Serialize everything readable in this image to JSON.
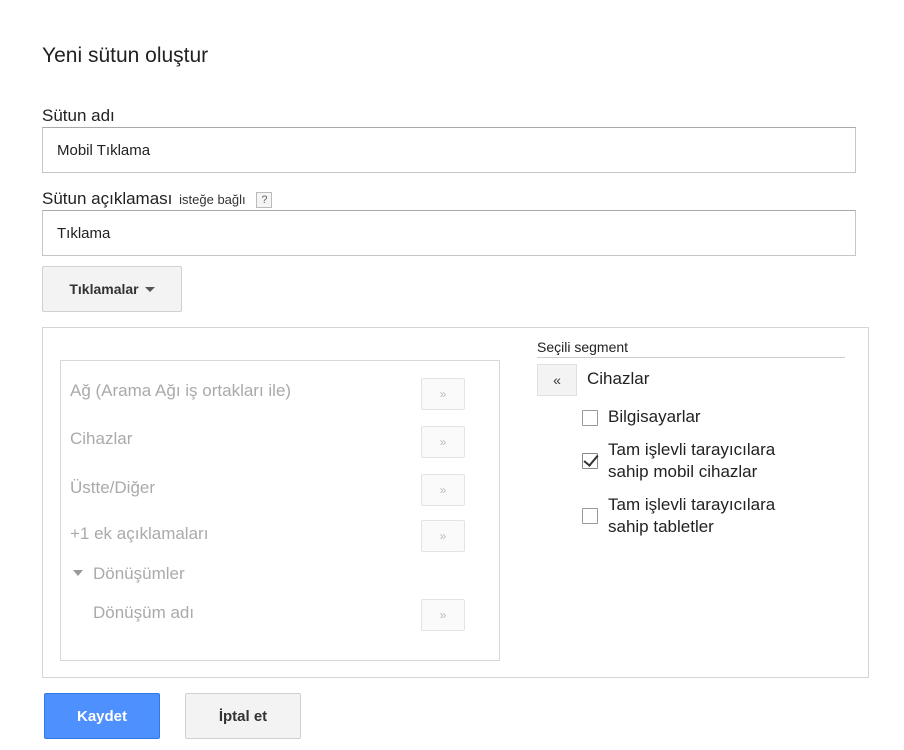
{
  "dialog": {
    "title": "Yeni sütun oluştur",
    "column_name": {
      "label": "Sütun adı",
      "value": "Mobil Tıklama"
    },
    "column_description": {
      "label": "Sütun açıklaması",
      "optional_text": "isteğe bağlı",
      "help_text": "?",
      "value": "Tıklama"
    },
    "metric_button_label": "Tıklamalar",
    "segments": {
      "items": [
        {
          "label": "Ağ (Arama Ağı iş ortakları ile)",
          "add_label": "»"
        },
        {
          "label": "Cihazlar",
          "add_label": "»"
        },
        {
          "label": "Üstte/Diğer",
          "add_label": "»"
        },
        {
          "label": "+1 ek açıklamaları",
          "add_label": "»"
        }
      ],
      "group": {
        "label": "Dönüşümler",
        "children": [
          {
            "label": "Dönüşüm adı",
            "add_label": "»"
          }
        ]
      }
    },
    "selected_segment": {
      "heading": "Seçili segment",
      "remove_label": "«",
      "name": "Cihazlar",
      "options": [
        {
          "label": "Bilgisayarlar",
          "checked": false
        },
        {
          "label_line1": "Tam işlevli tarayıcılara",
          "label_line2": "sahip mobil cihazlar",
          "checked": true
        },
        {
          "label_line1": "Tam işlevli tarayıcılara",
          "label_line2": "sahip tabletler",
          "checked": false
        }
      ]
    },
    "buttons": {
      "save": "Kaydet",
      "cancel": "İptal et"
    }
  }
}
